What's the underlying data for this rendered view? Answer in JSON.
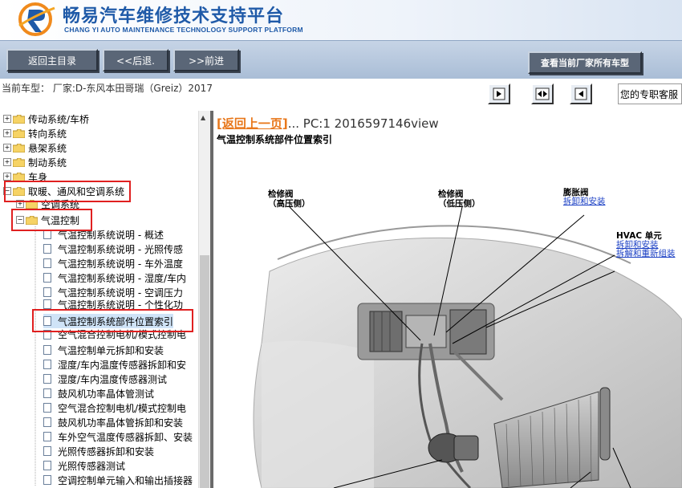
{
  "header": {
    "title": "畅易汽车维修技术支持平台",
    "subtitle": "CHANG YI AUTO MAINTENANCE TECHNOLOGY SUPPORT PLATFORM"
  },
  "toolbar": {
    "home_label": "返回主目录",
    "back_label": "<<后退.",
    "forward_label": ">>前进",
    "all_models_label": "查看当前厂家所有车型"
  },
  "info": {
    "current_model": "当前车型：  厂家:D-东风本田哥瑞（Greiz）2017",
    "service_text": "您的专职客服"
  },
  "tree": {
    "items": [
      {
        "label": "传动系统/车桥"
      },
      {
        "label": "转向系统"
      },
      {
        "label": "悬架系统"
      },
      {
        "label": "制动系统"
      },
      {
        "label": "车身"
      },
      {
        "label": "取暖、通风和空调系统"
      },
      {
        "label": "空调系统"
      },
      {
        "label": "气温控制"
      },
      {
        "label": "气温控制系统说明 - 概述"
      },
      {
        "label": "气温控制系统说明 - 光照传感"
      },
      {
        "label": "气温控制系统说明 - 车外温度"
      },
      {
        "label": "气温控制系统说明 - 湿度/车内"
      },
      {
        "label": "气温控制系统说明 - 空调压力"
      },
      {
        "label": "气温控制系统说明 - 个性化功"
      },
      {
        "label": "气温控制系统部件位置索引"
      },
      {
        "label": "空气混合控制电机/模式控制电"
      },
      {
        "label": "气温控制单元拆卸和安装"
      },
      {
        "label": "湿度/车内温度传感器拆卸和安"
      },
      {
        "label": "湿度/车内温度传感器测试"
      },
      {
        "label": "鼓风机功率晶体管测试"
      },
      {
        "label": "空气混合控制电机/模式控制电"
      },
      {
        "label": "鼓风机功率晶体管拆卸和安装"
      },
      {
        "label": "车外空气温度传感器拆卸、安装"
      },
      {
        "label": "光照传感器拆卸和安装"
      },
      {
        "label": "光照传感器测试"
      },
      {
        "label": "空调控制单元输入和输出插接器"
      }
    ]
  },
  "content": {
    "back_link": "[返回上一页]",
    "pc_info": "... PC:1 2016597146view",
    "page_title": "气温控制系统部件位置索引",
    "labels": {
      "valve_high_1": "检修阀",
      "valve_high_2": "（高压侧）",
      "valve_low_1": "检修阀",
      "valve_low_2": "（低压侧）",
      "expansion_valve": "膨胀阀",
      "expansion_link": "拆卸和安装",
      "hvac_unit": "HVAC 单元",
      "hvac_link1": "拆卸和安装",
      "hvac_link2": "拆解和重新组装"
    }
  },
  "colors": {
    "brand_blue": "#1f5aa8",
    "highlight_red": "#e02020",
    "link_orange": "#e8781c",
    "link_blue": "#1a3fc4"
  }
}
